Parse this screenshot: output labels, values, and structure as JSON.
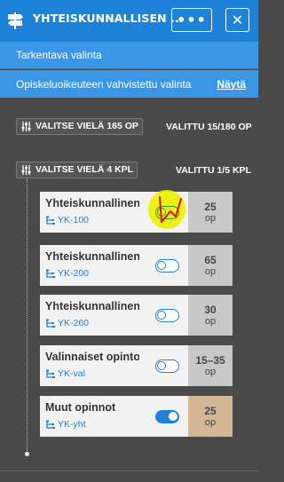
{
  "header": {
    "title": "YHTEISKUNNALLISEN ...",
    "more_label": "•••",
    "close_label": "✕"
  },
  "subbars": {
    "refine_label": "Tarkentava valinta",
    "confirmed_label": "Opiskeluoikeuteen vahvistettu valinta",
    "show_link": "Näytä"
  },
  "sections": [
    {
      "chip_label": "VALITSE VIELÄ 165 OP",
      "status": "VALITTU 15/180 OP"
    },
    {
      "chip_label": "VALITSE VIELÄ 4 KPL",
      "status": "VALITTU 1/5 KPL"
    }
  ],
  "courses": [
    {
      "name": "Yhteiskunnallinen ...",
      "code": "YK-100",
      "credits": "25",
      "unit": "op",
      "toggled": false
    },
    {
      "name": "Yhteiskunnallinen ...",
      "code": "YK-200",
      "credits": "65",
      "unit": "op",
      "toggled": false
    },
    {
      "name": "Yhteiskunnallinen ...",
      "code": "YK-260",
      "credits": "30",
      "unit": "op",
      "toggled": false
    },
    {
      "name": "Valinnaiset opintot",
      "code": "YK-val",
      "credits": "15–35",
      "unit": "op",
      "toggled": false
    },
    {
      "name": "Muut opinnot",
      "code": "YK-yht",
      "credits": "25",
      "unit": "op",
      "toggled": true
    }
  ],
  "colors": {
    "header_blue": "#1f82d9",
    "subbar_blue": "#3c96e6",
    "background": "#4a4a4a",
    "card": "#f2f2f2",
    "credits_gray": "#c8c8c8",
    "credits_tan": "#d4b896",
    "highlight": "#eef000",
    "annotation_red": "#e01010"
  },
  "icons": {
    "logo": "signpost-icon",
    "section": "sliders-icon",
    "code": "tree-icon"
  }
}
